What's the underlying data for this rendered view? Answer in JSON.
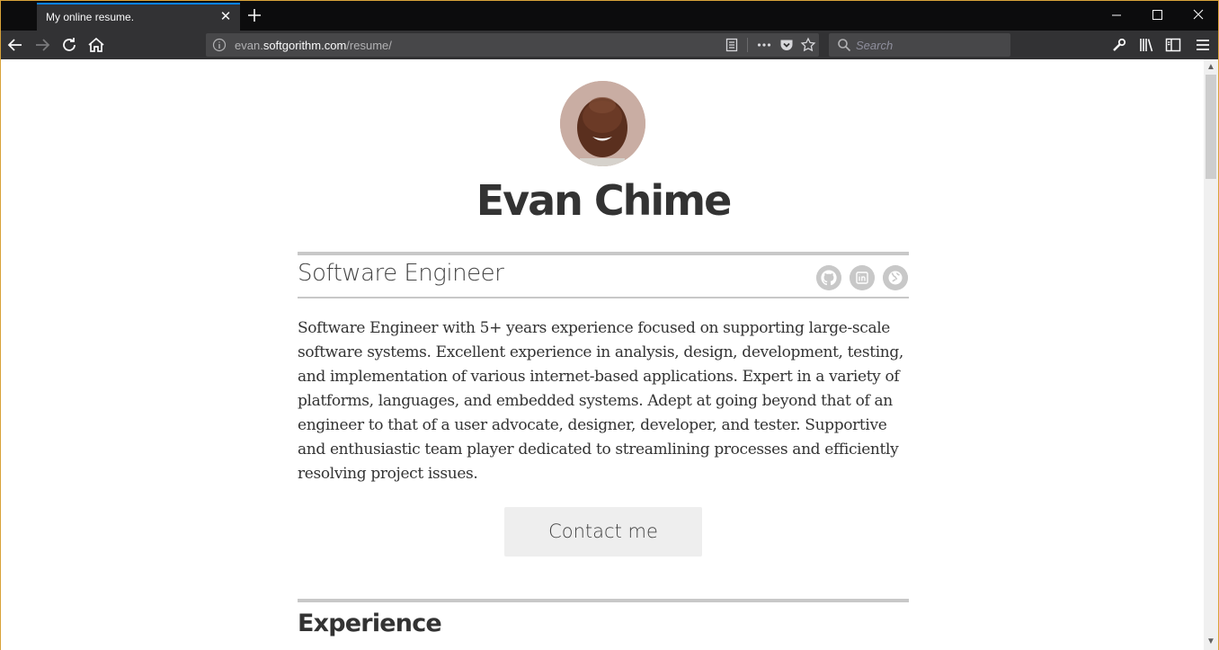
{
  "browser": {
    "tab_title": "My online resume.",
    "url_prefix": "evan.",
    "url_domain": "softgorithm.com",
    "url_path": "/resume/",
    "search_placeholder": "Search",
    "accent": "#0a84ff",
    "icons": [
      "close-icon",
      "plus-icon",
      "minimize-icon",
      "maximize-icon",
      "back-icon",
      "forward-icon",
      "reload-icon",
      "home-icon",
      "info-icon",
      "reader-view-icon",
      "more-icon",
      "pocket-icon",
      "star-icon",
      "search-icon",
      "wrench-icon",
      "library-icon",
      "sidebar-icon",
      "menu-icon"
    ]
  },
  "resume": {
    "name": "Evan Chime",
    "title": "Software Engineer",
    "social_icons": [
      "github-icon",
      "linkedin-icon",
      "globe-icon"
    ],
    "summary": "Software Engineer with 5+ years experience focused on supporting large-scale software systems. Excellent experience in analysis, design, development, testing, and implementation of various internet-based applications. Expert in a variety of platforms, languages, and embedded systems. Adept at going beyond that of an engineer to that of a user advocate, designer, developer, and tester. Supportive and enthusiastic team player dedicated to streamlining processes and efficiently resolving project issues.",
    "contact_label": "Contact me",
    "experience_heading": "Experience"
  }
}
